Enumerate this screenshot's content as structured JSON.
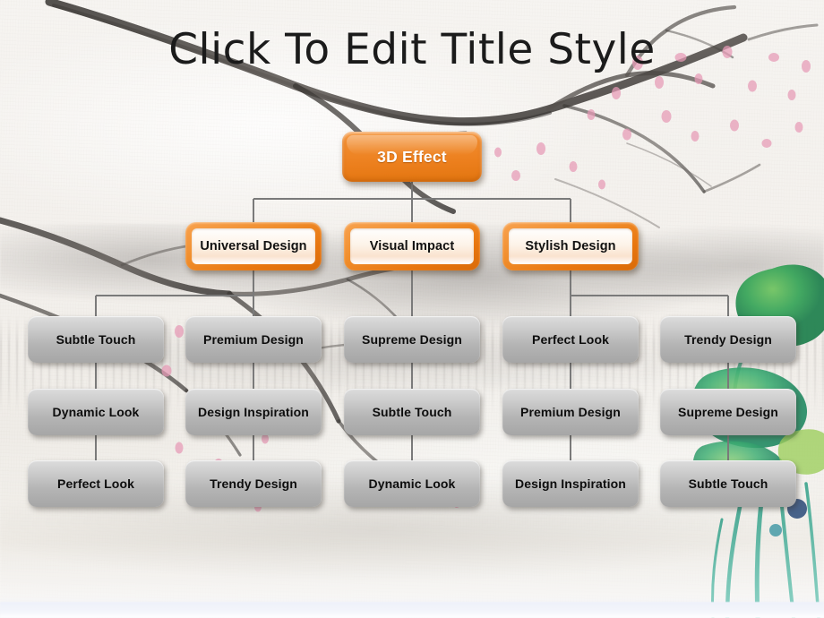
{
  "slide": {
    "title": "Click To Edit Title Style",
    "background": "sumi-e ink painting with plum branches, pink blossoms and green lotus leaves",
    "colors": {
      "accent_orange": "#ec7f1d",
      "node_grey": "#b4b4b4",
      "connector_grey": "#7a7a7a",
      "paper": "#f4f1ee",
      "title_text": "#1b1b1b"
    }
  },
  "chart_data": {
    "type": "diagram",
    "diagram_kind": "organization-chart",
    "title": "Click To Edit Title Style",
    "levels": 4,
    "root": {
      "label": "3D Effect",
      "style": "orange-solid"
    },
    "branches": [
      {
        "label": "Universal Design",
        "style": "orange-outline",
        "columns": [
          {
            "items": [
              "Subtle Touch",
              "Dynamic Look",
              "Perfect Look"
            ]
          },
          {
            "items": [
              "Premium Design",
              "Design Inspiration",
              "Trendy Design"
            ]
          }
        ]
      },
      {
        "label": "Visual Impact",
        "style": "orange-outline",
        "columns": [
          {
            "items": [
              "Supreme Design",
              "Subtle Touch",
              "Dynamic Look"
            ]
          }
        ]
      },
      {
        "label": "Stylish Design",
        "style": "orange-outline",
        "columns": [
          {
            "items": [
              "Perfect Look",
              "Premium Design",
              "Design Inspiration"
            ]
          },
          {
            "items": [
              "Trendy Design",
              "Supreme Design",
              "Subtle Touch"
            ]
          }
        ]
      }
    ]
  },
  "nodes": {
    "root": "3D Effect",
    "level2": [
      "Universal Design",
      "Visual Impact",
      "Stylish Design"
    ],
    "row3": [
      "Subtle Touch",
      "Premium Design",
      "Supreme Design",
      "Perfect Look",
      "Trendy Design"
    ],
    "row4": [
      "Dynamic Look",
      "Design Inspiration",
      "Subtle Touch",
      "Premium Design",
      "Supreme Design"
    ],
    "row5": [
      "Perfect Look",
      "Trendy Design",
      "Dynamic Look",
      "Design Inspiration",
      "Subtle Touch"
    ]
  }
}
